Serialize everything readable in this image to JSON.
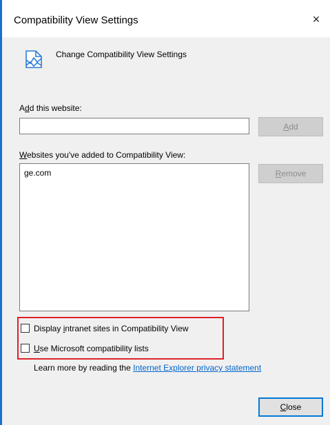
{
  "window": {
    "title": "Compatibility View Settings",
    "close_glyph": "×"
  },
  "header": {
    "icon": "compatibility-view-icon",
    "label": "Change Compatibility View Settings"
  },
  "add_website": {
    "label_prefix": "A",
    "label_accel": "d",
    "label_rest": "d this website:",
    "input_value": "",
    "button_accel": "A",
    "button_rest": "dd"
  },
  "websites": {
    "label_accel": "W",
    "label_rest": "ebsites you've added to Compatibility View:",
    "items": [
      "ge.com"
    ],
    "remove_accel": "R",
    "remove_rest": "emove"
  },
  "options": {
    "intranet_prefix": "Display ",
    "intranet_accel": "i",
    "intranet_rest": "ntranet sites in Compatibility View",
    "intranet_checked": false,
    "ms_accel": "U",
    "ms_rest": "se Microsoft compatibility lists",
    "ms_checked": false
  },
  "privacy": {
    "text": "Learn more by reading the",
    "link": "Internet Explorer privacy statement"
  },
  "footer": {
    "close_accel": "C",
    "close_rest": "lose"
  },
  "colors": {
    "accent": "#0078d7",
    "highlight": "#e01f26",
    "link": "#0066cc"
  }
}
